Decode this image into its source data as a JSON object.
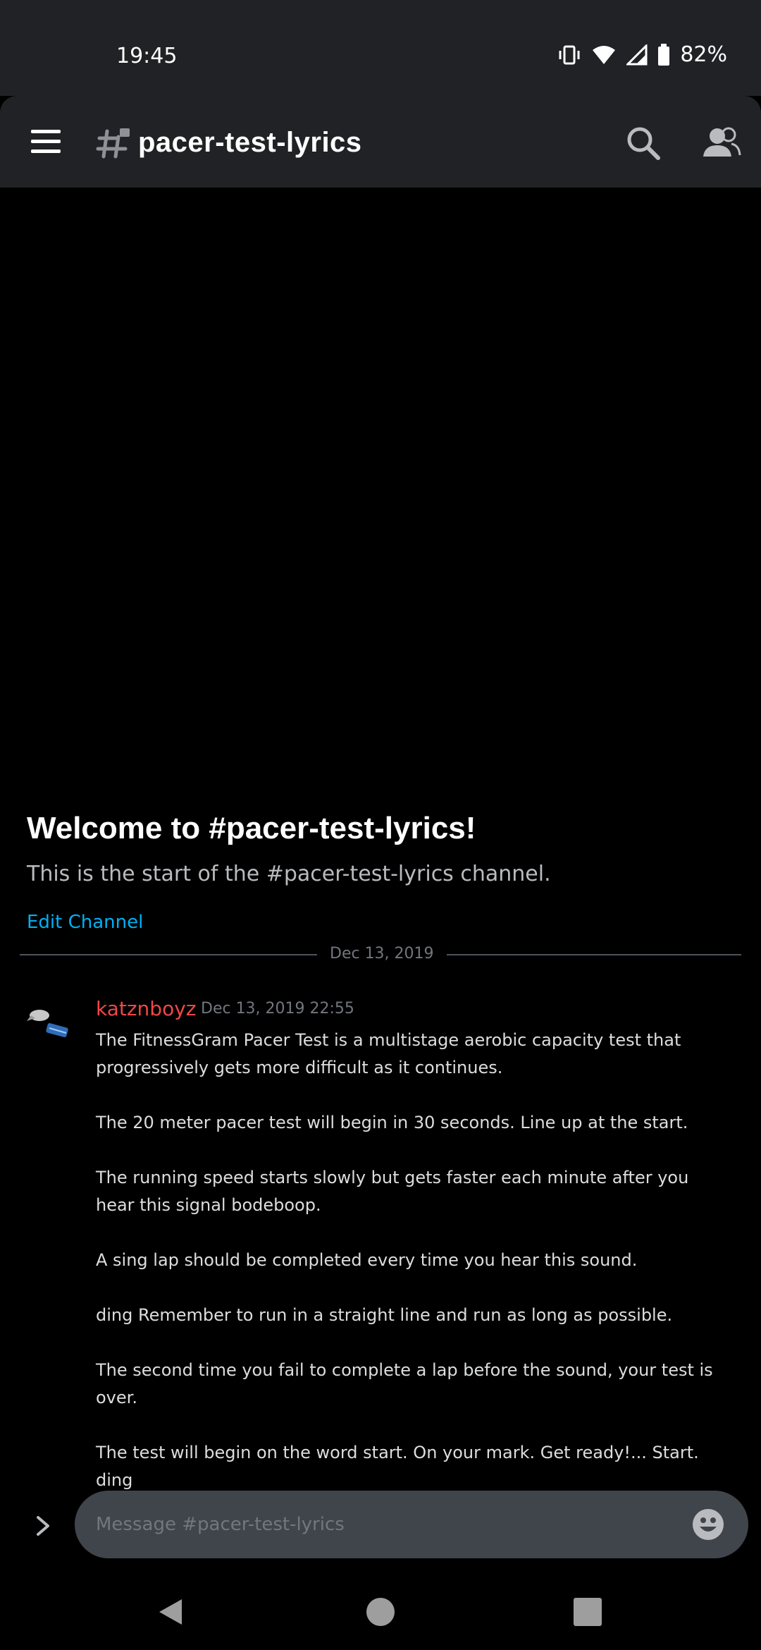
{
  "status": {
    "time": "19:45",
    "battery": "82%",
    "icons": [
      "vibrate-icon",
      "wifi-icon",
      "signal-icon",
      "battery-icon"
    ]
  },
  "appbar": {
    "channel_name": "pacer-test-lyrics",
    "icons": [
      "menu-icon",
      "hash-icon",
      "search-icon",
      "members-icon"
    ]
  },
  "welcome": {
    "title": "Welcome to #pacer-test-lyrics!",
    "subtitle": "This is the start of the #pacer-test-lyrics channel.",
    "edit_label": "Edit Channel"
  },
  "divider_date": "Dec 13, 2019",
  "message": {
    "author": "katznboyz",
    "timestamp": "Dec 13, 2019 22:55",
    "paragraphs": [
      "The FitnessGram Pacer Test is a multistage aerobic capacity test that progressively gets more difficult as it continues.",
      "The 20 meter pacer test will begin in 30 seconds. Line up at the start.",
      "The running speed starts slowly but gets faster each minute after you hear this signal bodeboop.",
      "A sing lap should be completed every time you hear this sound.",
      "ding Remember to run in a straight line and run as long as possible.",
      "The second time you fail to complete a lap before the sound, your test is over.",
      "The test will begin on the word start. On your mark. Get ready!... Start. ding"
    ]
  },
  "composer": {
    "placeholder": "Message #pacer-test-lyrics",
    "value": ""
  },
  "colors": {
    "accent_link": "#00b0f4",
    "author": "#f04747",
    "bar_bg": "#202225",
    "input_bg": "#40444b"
  }
}
